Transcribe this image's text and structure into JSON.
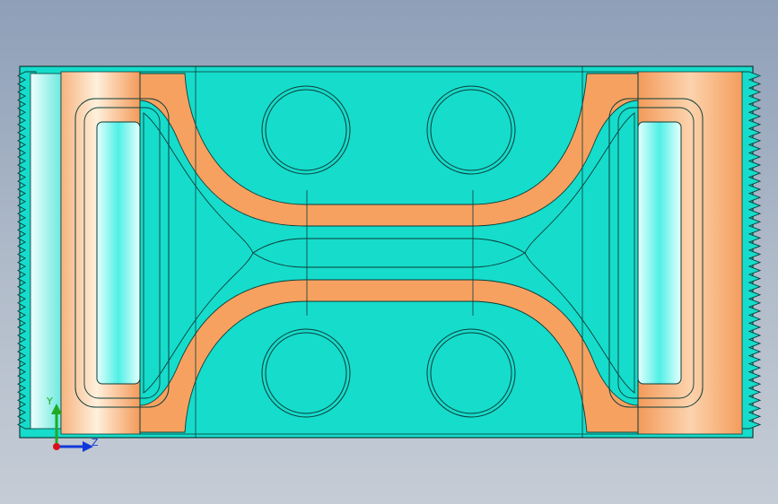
{
  "viewport": {
    "background_top": "#8e9fb8",
    "background_bottom": "#c5ccd6"
  },
  "part": {
    "colors": {
      "cyan": "#16dccb",
      "cyan_edge": "#0c5a54",
      "orange": "#f7a160",
      "orange_light": "#fde2c8",
      "light_cyan": "#a8f6f0"
    },
    "holes_count": 4
  },
  "triad": {
    "y_label": "Y",
    "z_label": "Z",
    "colors": {
      "y": "#1faa22",
      "z": "#1038d8",
      "x": "#d8101a"
    }
  }
}
